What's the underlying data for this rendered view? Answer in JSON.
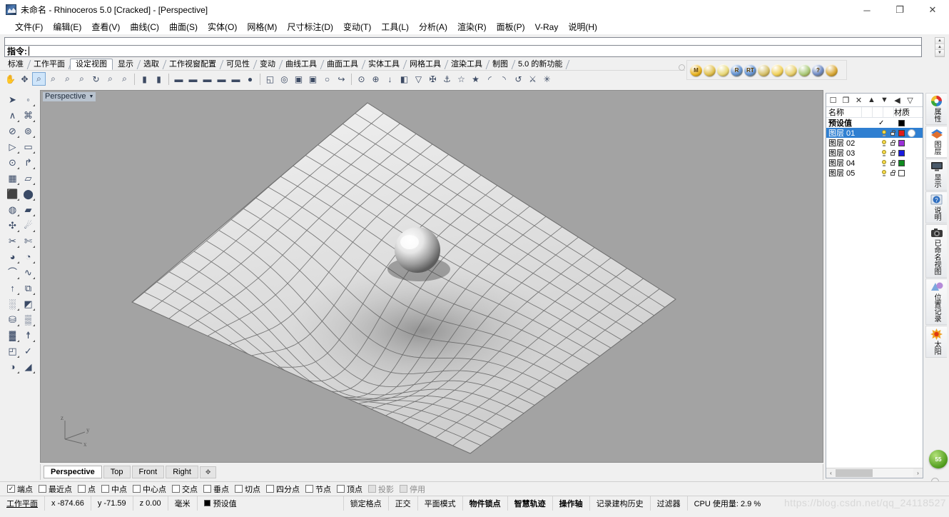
{
  "window": {
    "title": "未命名 - Rhinoceros 5.0 [Cracked] - [Perspective]",
    "app_icon": "rhino-icon",
    "controls": {
      "minimize": "─",
      "maximize": "❐",
      "close": "✕"
    }
  },
  "menubar": {
    "items": [
      {
        "label": "文件(F)"
      },
      {
        "label": "编辑(E)"
      },
      {
        "label": "查看(V)"
      },
      {
        "label": "曲线(C)"
      },
      {
        "label": "曲面(S)"
      },
      {
        "label": "实体(O)"
      },
      {
        "label": "网格(M)"
      },
      {
        "label": "尺寸标注(D)"
      },
      {
        "label": "变动(T)"
      },
      {
        "label": "工具(L)"
      },
      {
        "label": "分析(A)"
      },
      {
        "label": "渲染(R)"
      },
      {
        "label": "面板(P)"
      },
      {
        "label": "V-Ray"
      },
      {
        "label": "说明(H)"
      }
    ]
  },
  "command": {
    "prompt": "指令:",
    "value": "",
    "history": ""
  },
  "toolbar_tabs": {
    "active": "设定视图",
    "items": [
      {
        "label": "标准"
      },
      {
        "label": "工作平面"
      },
      {
        "label": "设定视图"
      },
      {
        "label": "显示"
      },
      {
        "label": "选取"
      },
      {
        "label": "工作视窗配置"
      },
      {
        "label": "可见性"
      },
      {
        "label": "变动"
      },
      {
        "label": "曲线工具"
      },
      {
        "label": "曲面工具"
      },
      {
        "label": "实体工具"
      },
      {
        "label": "网格工具"
      },
      {
        "label": "渲染工具"
      },
      {
        "label": "制图"
      },
      {
        "label": "5.0 的新功能"
      }
    ]
  },
  "icon_toolbar": {
    "items": [
      {
        "name": "pan-icon",
        "glyph": "✋",
        "selected": false
      },
      {
        "name": "zoom-extents-icon",
        "glyph": "✥",
        "selected": false
      },
      {
        "name": "zoom-window-icon",
        "glyph": "⌕",
        "selected": true
      },
      {
        "name": "zoom-selected-icon",
        "glyph": "⌕",
        "selected": false
      },
      {
        "name": "zoom-dynamic-icon",
        "glyph": "⌕",
        "selected": false
      },
      {
        "name": "zoom-in-icon",
        "glyph": "⌕",
        "selected": false
      },
      {
        "name": "rotate-view-icon",
        "glyph": "↻",
        "selected": false
      },
      {
        "name": "zoom-out-icon",
        "glyph": "⌕",
        "selected": false
      },
      {
        "name": "zoom-1to1-icon",
        "glyph": "⌕",
        "selected": false
      },
      {
        "name": "sep",
        "glyph": "",
        "selected": false
      },
      {
        "name": "view-front-icon",
        "glyph": "▮",
        "selected": false
      },
      {
        "name": "view-back-icon",
        "glyph": "▮",
        "selected": false
      },
      {
        "name": "sep",
        "glyph": "",
        "selected": false
      },
      {
        "name": "camera-set-icon",
        "glyph": "▬",
        "selected": false
      },
      {
        "name": "camera-target-icon",
        "glyph": "▬",
        "selected": false
      },
      {
        "name": "camera-lens-icon",
        "glyph": "▬",
        "selected": false
      },
      {
        "name": "camera-tilt-icon",
        "glyph": "▬",
        "selected": false
      },
      {
        "name": "camera-place-icon",
        "glyph": "▬",
        "selected": false
      },
      {
        "name": "camera-drag-icon",
        "glyph": "●",
        "selected": false
      },
      {
        "name": "sep",
        "glyph": "",
        "selected": false
      },
      {
        "name": "named-view-icon",
        "glyph": "◱",
        "selected": false
      },
      {
        "name": "photo-icon",
        "glyph": "◎",
        "selected": false
      },
      {
        "name": "save-view-icon",
        "glyph": "▣",
        "selected": false
      },
      {
        "name": "restore-view-icon",
        "glyph": "▣",
        "selected": false
      },
      {
        "name": "view-circle-icon",
        "glyph": "○",
        "selected": false
      },
      {
        "name": "view-rotate2-icon",
        "glyph": "↪",
        "selected": false
      },
      {
        "name": "sep",
        "glyph": "",
        "selected": false
      },
      {
        "name": "turntable-icon",
        "glyph": "⊙",
        "selected": false
      },
      {
        "name": "spin-icon",
        "glyph": "⊕",
        "selected": false
      },
      {
        "name": "walk-icon",
        "glyph": "↓",
        "selected": false
      },
      {
        "name": "clipping-plane-icon",
        "glyph": "◧",
        "selected": false
      },
      {
        "name": "cone-view-icon",
        "glyph": "▽",
        "selected": false
      },
      {
        "name": "stereo-icon",
        "glyph": "✠",
        "selected": false
      },
      {
        "name": "two-point-icon",
        "glyph": "⚓",
        "selected": false
      },
      {
        "name": "star-outline-icon",
        "glyph": "☆",
        "selected": false
      },
      {
        "name": "star-filled-icon",
        "glyph": "★",
        "selected": false
      },
      {
        "name": "blue-swoosh-icon",
        "glyph": "◜",
        "selected": false
      },
      {
        "name": "blue-swoosh2-icon",
        "glyph": "◝",
        "selected": false
      },
      {
        "name": "loop-view-icon",
        "glyph": "↺",
        "selected": false
      },
      {
        "name": "walkthrough-icon",
        "glyph": "⚔",
        "selected": false
      },
      {
        "name": "snapshot-icon",
        "glyph": "✳",
        "selected": false
      }
    ]
  },
  "vray_toolbar": {
    "items": [
      {
        "name": "vray-material-editor-icon",
        "label": "M",
        "color": "#e8b322"
      },
      {
        "name": "vray-light-icon",
        "label": "",
        "color": "#e0c050"
      },
      {
        "name": "vray-light2-icon",
        "label": "",
        "color": "#e8d878"
      },
      {
        "name": "vray-render-icon",
        "label": "R",
        "color": "#5e8fd0"
      },
      {
        "name": "vray-rt-render-icon",
        "label": "RT",
        "color": "#5e8fd0"
      },
      {
        "name": "vray-infinite-plane-icon",
        "label": "",
        "color": "#d5c06a"
      },
      {
        "name": "vray-sun-icon",
        "label": "",
        "color": "#f0d05a"
      },
      {
        "name": "vray-dome-icon",
        "label": "",
        "color": "#e8d070"
      },
      {
        "name": "vray-proxy-icon",
        "label": "",
        "color": "#a8c878"
      },
      {
        "name": "vray-help-icon",
        "label": "?",
        "color": "#6a86c0"
      },
      {
        "name": "vray-options-icon",
        "label": "",
        "color": "#d8a838"
      }
    ]
  },
  "left_palette": {
    "items": [
      {
        "name": "select-tool",
        "glyph": "➤",
        "mark": false
      },
      {
        "name": "point-tool",
        "glyph": "◦",
        "mark": true
      },
      {
        "name": "polyline-tool",
        "glyph": "∧",
        "mark": true
      },
      {
        "name": "control-point-curve-tool",
        "glyph": "⌘",
        "mark": true
      },
      {
        "name": "circle-tool",
        "glyph": "⊘",
        "mark": true
      },
      {
        "name": "ellipse-tool",
        "glyph": "⊚",
        "mark": true
      },
      {
        "name": "arc-tool",
        "glyph": "▷",
        "mark": true
      },
      {
        "name": "rectangle-tool",
        "glyph": "▭",
        "mark": true
      },
      {
        "name": "circle-center-tool",
        "glyph": "⊙",
        "mark": true
      },
      {
        "name": "fillet-tool",
        "glyph": "↱",
        "mark": true
      },
      {
        "name": "surface-from-curves-tool",
        "glyph": "▦",
        "mark": true
      },
      {
        "name": "extrude-surface-tool",
        "glyph": "▱",
        "mark": true
      },
      {
        "name": "box-tool",
        "glyph": "⬛",
        "mark": true
      },
      {
        "name": "sphere-tool",
        "glyph": "⬤",
        "mark": true
      },
      {
        "name": "cylinder-tool",
        "glyph": "◍",
        "mark": true
      },
      {
        "name": "pipe-tool",
        "glyph": "▰",
        "mark": true
      },
      {
        "name": "boolean-union-tool",
        "glyph": "✣",
        "mark": true
      },
      {
        "name": "explode-tool",
        "glyph": "☄",
        "mark": true
      },
      {
        "name": "trim-tool",
        "glyph": "✂",
        "mark": true
      },
      {
        "name": "split-tool",
        "glyph": "✄",
        "mark": true
      },
      {
        "name": "fillet-edge-tool",
        "glyph": "◕",
        "mark": true
      },
      {
        "name": "chamfer-edge-tool",
        "glyph": "◔",
        "mark": true
      },
      {
        "name": "blend-curve-tool",
        "glyph": "⌒",
        "mark": true
      },
      {
        "name": "blend-surface-tool",
        "glyph": "∿",
        "mark": true
      },
      {
        "name": "extrude-straight-tool",
        "glyph": "↑",
        "mark": true
      },
      {
        "name": "offset-tool",
        "glyph": "⧉",
        "mark": true
      },
      {
        "name": "array-tool",
        "glyph": "░",
        "mark": true
      },
      {
        "name": "mirror-tool",
        "glyph": "◩",
        "mark": true
      },
      {
        "name": "cap-tool",
        "glyph": "⛁",
        "mark": true
      },
      {
        "name": "mesh-tool",
        "glyph": "▒",
        "mark": true
      },
      {
        "name": "grid-tool",
        "glyph": "▓",
        "mark": true
      },
      {
        "name": "analysis-tool",
        "glyph": "☨",
        "mark": true
      },
      {
        "name": "layout-tool",
        "glyph": "◰",
        "mark": true
      },
      {
        "name": "check-tool",
        "glyph": "✓",
        "mark": false
      },
      {
        "name": "render-tool",
        "glyph": "◑",
        "mark": true
      },
      {
        "name": "material-tool",
        "glyph": "◢",
        "mark": true
      }
    ]
  },
  "viewport": {
    "label": "Perspective",
    "background_color": "#a3a3a3",
    "axis": {
      "x": "x",
      "y": "y",
      "z": "z"
    },
    "scene_description": "灰色网格曲面被球体压出凹陷（时空弯曲示意）",
    "tabs": [
      {
        "label": "Perspective",
        "active": true
      },
      {
        "label": "Top",
        "active": false
      },
      {
        "label": "Front",
        "active": false
      },
      {
        "label": "Right",
        "active": false
      },
      {
        "label": "✥",
        "active": false,
        "name": "add-viewport-tab"
      }
    ]
  },
  "layer_panel": {
    "toolbar_icons": [
      {
        "name": "new-layer-icon",
        "glyph": "☐"
      },
      {
        "name": "copy-layer-icon",
        "glyph": "❐"
      },
      {
        "name": "delete-layer-icon",
        "glyph": "✕"
      },
      {
        "name": "move-layer-up-icon",
        "glyph": "▲"
      },
      {
        "name": "move-layer-down-icon",
        "glyph": "▼"
      },
      {
        "name": "move-layer-left-icon",
        "glyph": "◀"
      },
      {
        "name": "filter-layer-icon",
        "glyph": "▽"
      }
    ],
    "columns": {
      "name": "名称",
      "material": "材质"
    },
    "rows": [
      {
        "name": "预设值",
        "checked": true,
        "bulb": false,
        "lock": false,
        "color": "#000000",
        "selected": false,
        "bold": true,
        "material": false
      },
      {
        "name": "图层 01",
        "checked": false,
        "bulb": true,
        "lock": true,
        "color": "#e01b1b",
        "selected": true,
        "bold": false,
        "material": true
      },
      {
        "name": "图层 02",
        "checked": false,
        "bulb": true,
        "lock": true,
        "color": "#9b30d9",
        "selected": false,
        "bold": false,
        "material": false
      },
      {
        "name": "图层 03",
        "checked": false,
        "bulb": true,
        "lock": true,
        "color": "#1a1ae0",
        "selected": false,
        "bold": false,
        "material": false
      },
      {
        "name": "图层 04",
        "checked": false,
        "bulb": true,
        "lock": true,
        "color": "#0f8a1f",
        "selected": false,
        "bold": false,
        "material": false
      },
      {
        "name": "图层 05",
        "checked": false,
        "bulb": true,
        "lock": true,
        "color": "#ffffff",
        "selected": false,
        "bold": false,
        "material": false
      }
    ],
    "hscroll": {
      "left": "‹",
      "right": "›"
    }
  },
  "right_dock": {
    "items": [
      {
        "label": "属性",
        "name": "panel-tab-properties",
        "icon": "color-wheel-icon",
        "active": false
      },
      {
        "label": "图层",
        "name": "panel-tab-layers",
        "icon": "layers-icon",
        "active": true
      },
      {
        "label": "显示",
        "name": "panel-tab-display",
        "icon": "monitor-icon",
        "active": false
      },
      {
        "label": "说明",
        "name": "panel-tab-help",
        "icon": "help-icon",
        "active": false
      },
      {
        "label": "已命名视图",
        "name": "panel-tab-named-views",
        "icon": "camera-icon",
        "active": false
      },
      {
        "label": "位置记录",
        "name": "panel-tab-bookmarks",
        "icon": "bookmark-icon",
        "active": false
      },
      {
        "label": "太阳",
        "name": "panel-tab-sun",
        "icon": "sun-icon",
        "active": false
      }
    ],
    "orb_label": "55"
  },
  "snapbar": {
    "items": [
      {
        "label": "端点",
        "checked": true,
        "disabled": false
      },
      {
        "label": "最近点",
        "checked": false,
        "disabled": false
      },
      {
        "label": "点",
        "checked": false,
        "disabled": false
      },
      {
        "label": "中点",
        "checked": false,
        "disabled": false
      },
      {
        "label": "中心点",
        "checked": false,
        "disabled": false
      },
      {
        "label": "交点",
        "checked": false,
        "disabled": false
      },
      {
        "label": "垂点",
        "checked": false,
        "disabled": false
      },
      {
        "label": "切点",
        "checked": false,
        "disabled": false
      },
      {
        "label": "四分点",
        "checked": false,
        "disabled": false
      },
      {
        "label": "节点",
        "checked": false,
        "disabled": false
      },
      {
        "label": "顶点",
        "checked": false,
        "disabled": false
      },
      {
        "label": "投影",
        "checked": false,
        "disabled": true
      },
      {
        "label": "停用",
        "checked": false,
        "disabled": true
      }
    ]
  },
  "statusbar": {
    "cplane": "工作平面",
    "x": "x -874.66",
    "y": "y -71.59",
    "z": "z 0.00",
    "units": "毫米",
    "layer": "预设值",
    "layer_color": "#000000",
    "toggles": [
      {
        "label": "锁定格点",
        "bold": false
      },
      {
        "label": "正交",
        "bold": false
      },
      {
        "label": "平面模式",
        "bold": false
      },
      {
        "label": "物件锁点",
        "bold": true
      },
      {
        "label": "智慧轨迹",
        "bold": true
      },
      {
        "label": "操作轴",
        "bold": true
      },
      {
        "label": "记录建构历史",
        "bold": false
      },
      {
        "label": "过滤器",
        "bold": false
      }
    ],
    "cpu": "CPU 使用量: 2.9 %",
    "watermark": "https://blog.csdn.net/qq_24118527"
  }
}
